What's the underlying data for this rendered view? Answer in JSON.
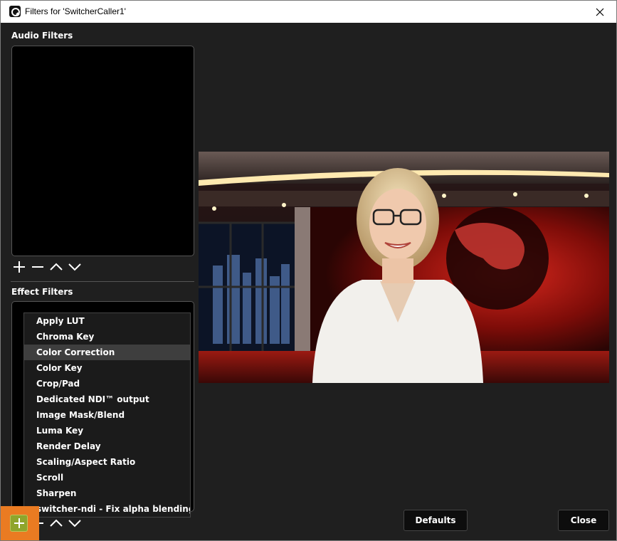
{
  "window": {
    "title": "Filters for 'SwitcherCaller1'"
  },
  "audio_filters": {
    "label": "Audio Filters",
    "toolbar": [
      "plus-icon",
      "minus-icon",
      "chevron-up-icon",
      "chevron-down-icon"
    ]
  },
  "effect_filters": {
    "label": "Effect Filters"
  },
  "add_filter_menu": {
    "items": [
      "Apply LUT",
      "Chroma Key",
      "Color Correction",
      "Color Key",
      "Crop/Pad",
      "Dedicated NDI™ output",
      "Image Mask/Blend",
      "Luma Key",
      "Render Delay",
      "Scaling/Aspect Ratio",
      "Scroll",
      "Sharpen",
      "switcher-ndi - Fix alpha blending"
    ],
    "highlighted": "Color Correction"
  },
  "buttons": {
    "defaults": "Defaults",
    "close": "Close"
  },
  "colors": {
    "background": "#1f1f1f",
    "highlight": "#ea7b22",
    "add_button": "#8fa52c"
  }
}
